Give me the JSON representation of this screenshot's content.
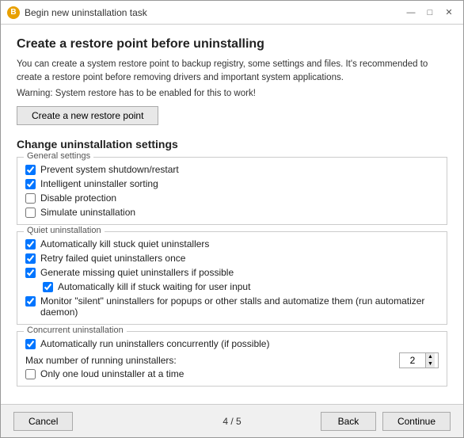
{
  "window": {
    "title": "Begin new uninstallation task",
    "icon": "B"
  },
  "titlebar_controls": {
    "minimize": "—",
    "maximize": "□",
    "close": "✕"
  },
  "restore_section": {
    "heading": "Create a restore point before uninstalling",
    "description": "You can create a system restore point to backup registry, some settings and files. It's recommended to create a restore point before removing drivers and important system applications.",
    "warning": "Warning: System restore has to be enabled for this to work!",
    "button_label": "Create a new restore point"
  },
  "settings_section": {
    "heading": "Change uninstallation settings",
    "groups": [
      {
        "label": "General settings",
        "items": [
          {
            "text": "Prevent system shutdown/restart",
            "checked": true
          },
          {
            "text": "Intelligent uninstaller sorting",
            "checked": true
          },
          {
            "text": "Disable protection",
            "checked": false
          },
          {
            "text": "Simulate uninstallation",
            "checked": false
          }
        ]
      },
      {
        "label": "Quiet uninstallation",
        "items": [
          {
            "text": "Automatically kill stuck quiet uninstallers",
            "checked": true,
            "indented": false
          },
          {
            "text": "Retry failed quiet uninstallers once",
            "checked": true,
            "indented": false
          },
          {
            "text": "Generate missing quiet uninstallers if possible",
            "checked": true,
            "indented": false
          },
          {
            "text": "Automatically kill if stuck waiting for user input",
            "checked": true,
            "indented": true
          },
          {
            "text": "Monitor \"silent\" uninstallers for popups or other stalls and automatize them (run automatizer daemon)",
            "checked": true,
            "indented": false,
            "multiline": true
          }
        ]
      },
      {
        "label": "Concurrent uninstallation",
        "items": [
          {
            "text": "Automatically run uninstallers concurrently (if possible)",
            "checked": true,
            "indented": false
          },
          {
            "text": "Max number of running uninstallers:",
            "checked": false,
            "is_spinner": true,
            "spinner_value": "2",
            "indented": false
          },
          {
            "text": "Only one loud uninstaller at a time",
            "checked": false,
            "indented": false
          }
        ]
      }
    ]
  },
  "footer": {
    "cancel_label": "Cancel",
    "progress": "4 / 5",
    "back_label": "Back",
    "continue_label": "Continue"
  }
}
